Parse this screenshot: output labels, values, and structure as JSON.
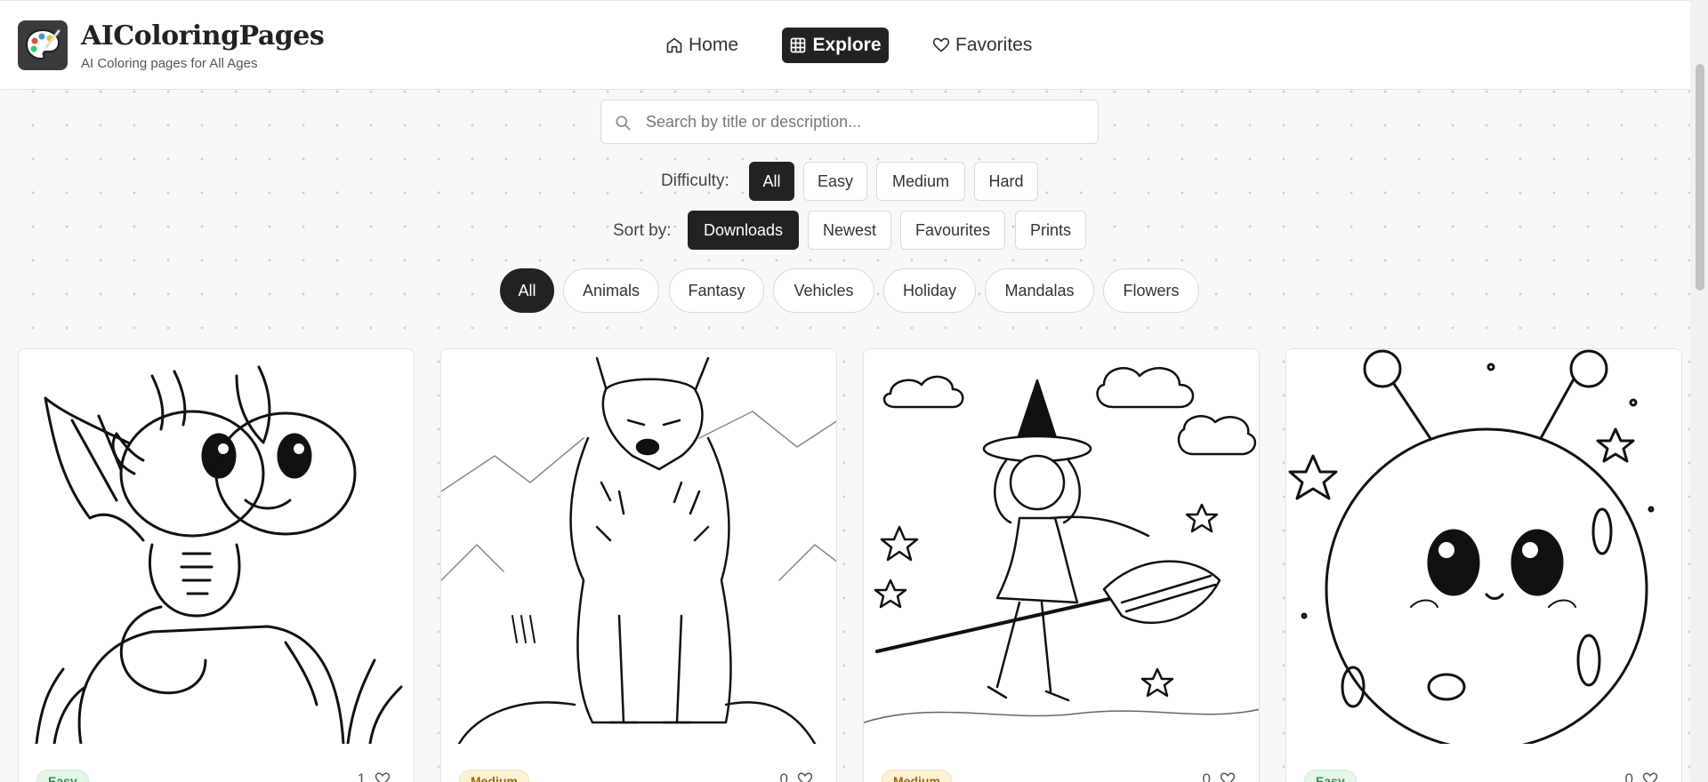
{
  "header": {
    "brand_name": "AIColoringPages",
    "tagline": "AI Coloring pages for All Ages",
    "nav": [
      {
        "label": "Home",
        "icon": "home-icon"
      },
      {
        "label": "Explore",
        "icon": "grid-icon",
        "active": true
      },
      {
        "label": "Favorites",
        "icon": "heart-icon"
      }
    ]
  },
  "search": {
    "placeholder": "Search by title or description..."
  },
  "filters": {
    "difficulty_label": "Difficulty:",
    "difficulty_options": [
      "All",
      "Easy",
      "Medium",
      "Hard"
    ],
    "difficulty_selected": "All",
    "sort_label": "Sort by:",
    "sort_options": [
      "Downloads",
      "Newest",
      "Favourites",
      "Prints"
    ],
    "sort_selected": "Downloads"
  },
  "categories": {
    "items": [
      "All",
      "Animals",
      "Fantasy",
      "Vehicles",
      "Holiday",
      "Mandalas",
      "Flowers"
    ],
    "selected": "All"
  },
  "cards": [
    {
      "subject": "baby dragon on a rock",
      "difficulty": "Easy",
      "favorites": "1"
    },
    {
      "subject": "wolf in the mountains",
      "difficulty": "Medium",
      "favorites": "0"
    },
    {
      "subject": "witch flying on a broomstick",
      "difficulty": "Medium",
      "favorites": "0"
    },
    {
      "subject": "cute alien in space",
      "difficulty": "Easy",
      "favorites": "0"
    }
  ],
  "colors": {
    "accent": "#222222",
    "easy": "#2f8f4e",
    "medium": "#9a6a00"
  }
}
